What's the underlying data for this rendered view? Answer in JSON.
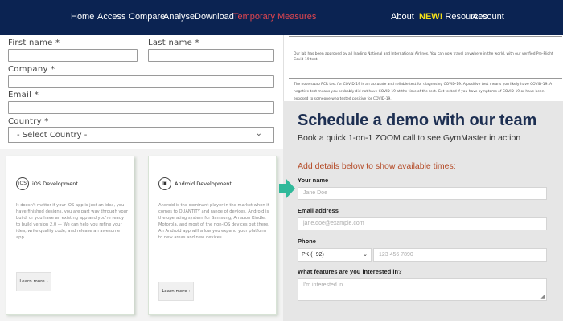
{
  "nav": {
    "left_items": [
      "Home",
      "Access",
      "Compare",
      "Analyse",
      "Download",
      "Temporary Measures"
    ],
    "right_items": {
      "about": "About",
      "new_badge": "NEW!",
      "resources": "Resources",
      "account": "Account"
    },
    "colors": {
      "background": "#0b2352",
      "highlight": "#e2464f",
      "new_badge": "#f5e11a"
    }
  },
  "left_form": {
    "first_name_label": "First name *",
    "last_name_label": "Last name *",
    "company_label": "Company *",
    "email_label": "Email *",
    "country_label": "Country *",
    "country_selected": "- Select Country -"
  },
  "cards": [
    {
      "icon": "ios-icon",
      "icon_text": "iOS",
      "title": "iOS Development",
      "description": "It doesn't matter if your iOS app is just an idea, you have finished designs, you are part way through your build, or you have an existing app and you're ready to build version 2.0 — We can help you refine your idea, write quality code, and release an awesome app.",
      "button": "Learn more ›"
    },
    {
      "icon": "android-icon",
      "icon_text": "▣",
      "title": "Android Development",
      "description": "Android is the dominant player in the market when it comes to QUANTITY and range of devices. Android is the operating system for Samsung, Amazon Kindle, Motorola, and most of the non-iOS devices out there. An Android app will allow you expand your platform to new areas and new devices.",
      "button": "Learn more ›"
    }
  ],
  "right_top": {
    "paragraph1": "Our lab has been approved by all leading National and International Airlines. You can now travel anywhere in the world, with our verified Pre-Flight Covid-19 test.",
    "paragraph2": "The nose swab PCR test for COVID-19 is an accurate and reliable test for diagnosing COVID-19. A positive test means you likely have COVID-19. A negative test means you probably did not have COVID-19 at the time of the test. Get tested if you have symptoms of COVID-19 or have been exposed to someone who tested positive for COVID-19."
  },
  "demo": {
    "title": "Schedule a demo with our team",
    "subtitle": "Book a quick 1-on-1 ZOOM call to see GymMaster in action",
    "add_details": "Add details below to show available times:",
    "name_label": "Your name",
    "name_placeholder": "Jane Doe",
    "email_label": "Email address",
    "email_placeholder": "jane.doe@example.com",
    "phone_label": "Phone",
    "phone_country": "PK (+92)",
    "phone_placeholder": "123 456 7890",
    "features_label": "What features are you interested in?",
    "features_placeholder": "I'm interested in...",
    "colors": {
      "title": "#1d2f52",
      "accent": "#b44a26",
      "panel": "#e6e6e6",
      "arrow": "#2fb99a"
    }
  }
}
